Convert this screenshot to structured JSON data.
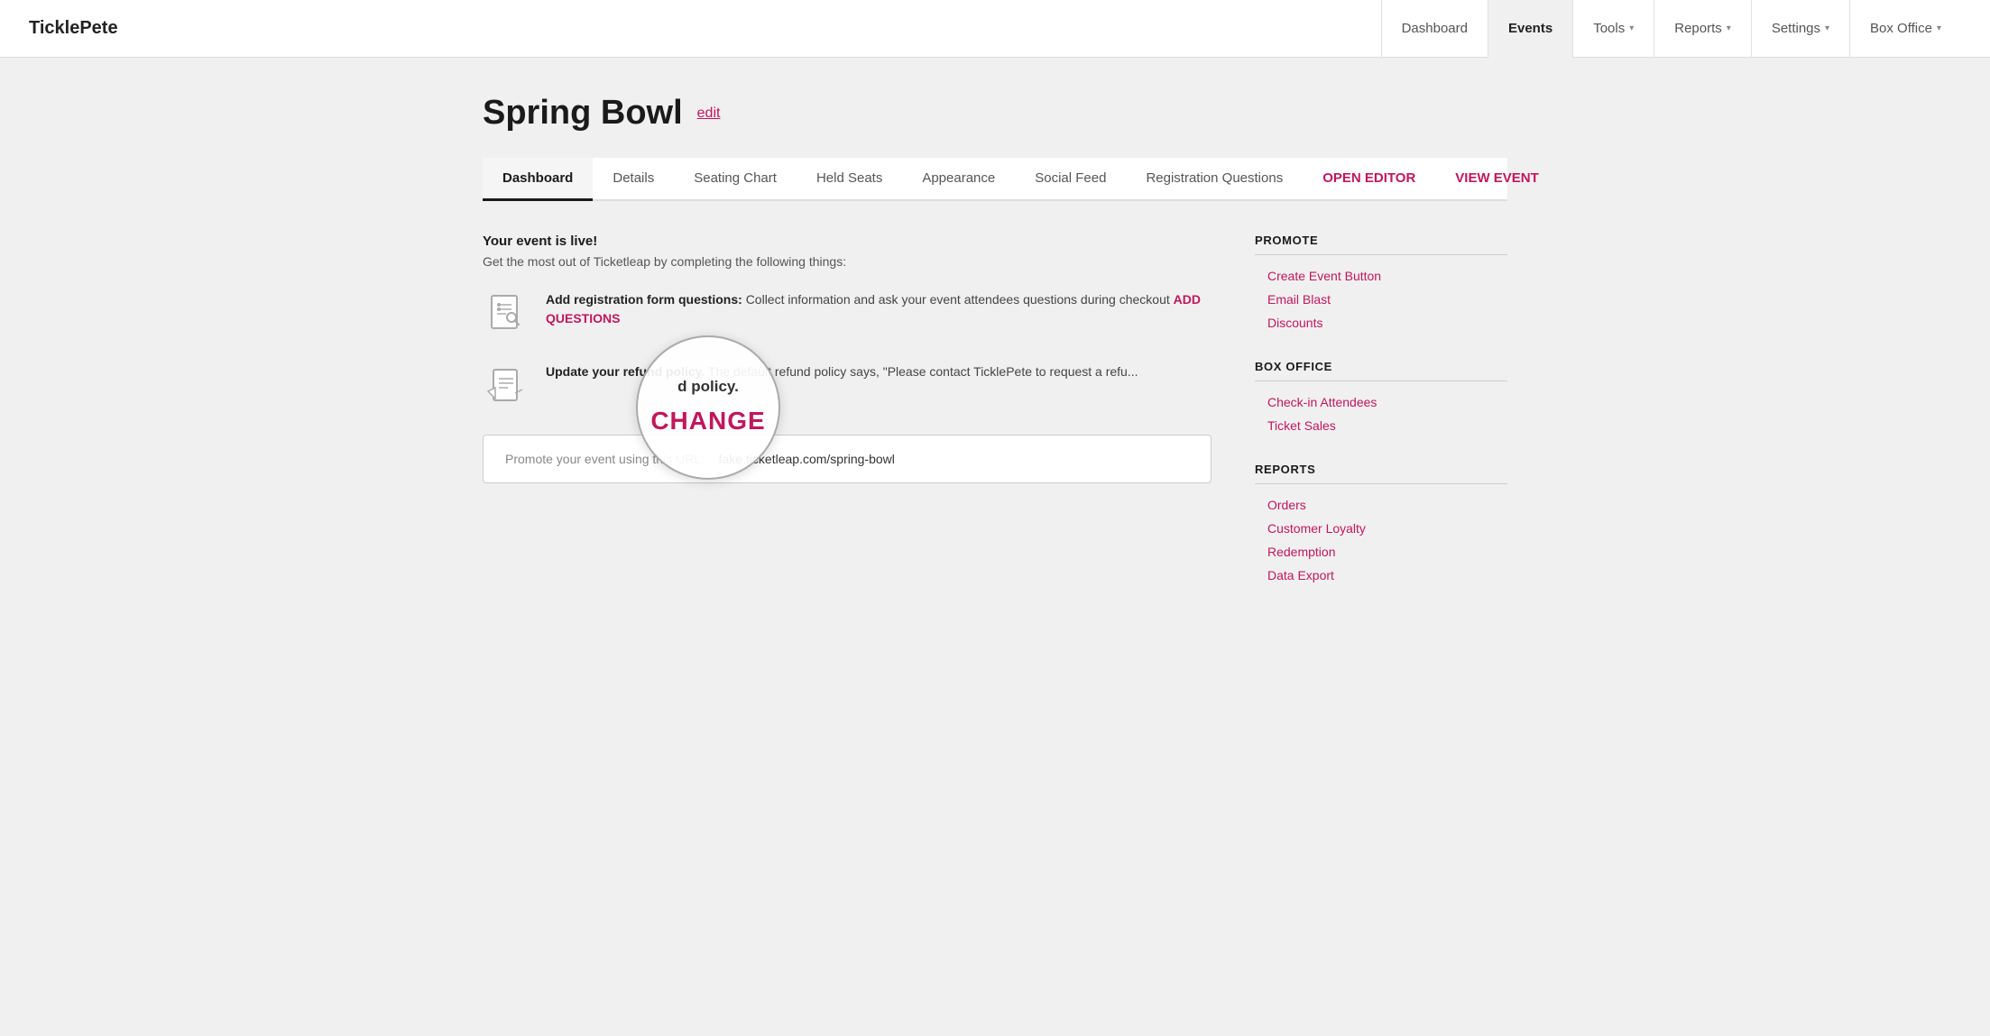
{
  "logo": "TicklePete",
  "nav": {
    "items": [
      {
        "label": "Dashboard",
        "active": false,
        "has_caret": false
      },
      {
        "label": "Events",
        "active": true,
        "has_caret": false
      },
      {
        "label": "Tools",
        "active": false,
        "has_caret": true
      },
      {
        "label": "Reports",
        "active": false,
        "has_caret": true
      },
      {
        "label": "Settings",
        "active": false,
        "has_caret": true
      },
      {
        "label": "Box Office",
        "active": false,
        "has_caret": true
      }
    ]
  },
  "page": {
    "title": "Spring Bowl",
    "edit_label": "edit"
  },
  "event_tabs": [
    {
      "label": "Dashboard",
      "active": true
    },
    {
      "label": "Details",
      "active": false
    },
    {
      "label": "Seating Chart",
      "active": false
    },
    {
      "label": "Held Seats",
      "active": false
    },
    {
      "label": "Appearance",
      "active": false
    },
    {
      "label": "Social Feed",
      "active": false
    },
    {
      "label": "Registration Questions",
      "active": false
    }
  ],
  "event_actions": [
    {
      "label": "OPEN EDITOR"
    },
    {
      "label": "VIEW EVENT"
    }
  ],
  "main": {
    "live_heading": "Your event is live!",
    "live_sub": "Get the most out of Ticketleap by completing the following things:",
    "tasks": [
      {
        "id": "registration",
        "bold": "Add registration form questions:",
        "text": " Collect information and ask your event attendees questions during checkout ",
        "link": "ADD QUESTIONS"
      },
      {
        "id": "refund",
        "bold": "Update your refund policy.",
        "text": " The default refund policy says, \"Please contact TicklePete to request a refu..."
      }
    ],
    "magnifier": {
      "top_text": "d policy.",
      "change_label": "CHANGE"
    },
    "url_box": {
      "label": "Promote your event using this URL:",
      "url": "fake.ticketleap.com/spring-bowl"
    }
  },
  "sidebar": {
    "sections": [
      {
        "id": "promote",
        "title": "PROMOTE",
        "links": [
          {
            "label": "Create Event Button"
          },
          {
            "label": "Email Blast"
          },
          {
            "label": "Discounts"
          }
        ]
      },
      {
        "id": "box_office",
        "title": "BOX OFFICE",
        "links": [
          {
            "label": "Check-in Attendees"
          },
          {
            "label": "Ticket Sales"
          }
        ]
      },
      {
        "id": "reports",
        "title": "REPORTS",
        "links": [
          {
            "label": "Orders"
          },
          {
            "label": "Customer Loyalty"
          },
          {
            "label": "Redemption"
          },
          {
            "label": "Data Export"
          }
        ]
      }
    ]
  }
}
